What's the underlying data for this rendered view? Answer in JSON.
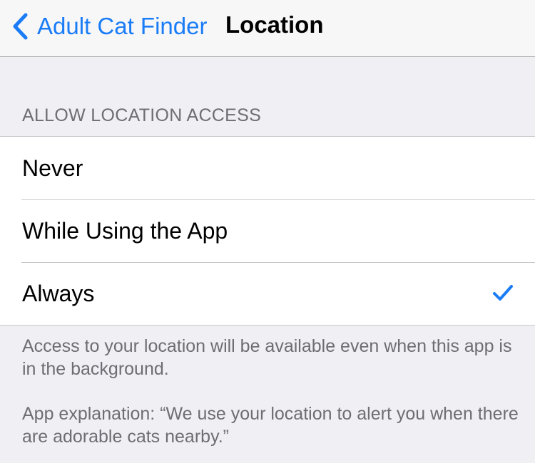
{
  "navbar": {
    "back_label": "Adult Cat Finder",
    "title": "Location",
    "back_icon": "chevron-left-icon"
  },
  "section": {
    "header": "ALLOW LOCATION ACCESS",
    "options": [
      {
        "label": "Never",
        "selected": false
      },
      {
        "label": "While Using the App",
        "selected": false
      },
      {
        "label": "Always",
        "selected": true
      }
    ],
    "check_icon": "checkmark-icon"
  },
  "footer": {
    "note": "Access to your location will be available even when this app is in the background.",
    "explanation": "App explanation: “We use your location to alert you when there are adorable cats nearby.”"
  },
  "colors": {
    "accent": "#1a7cf6",
    "background": "#efeff4",
    "secondary_text": "#6d6d72"
  }
}
